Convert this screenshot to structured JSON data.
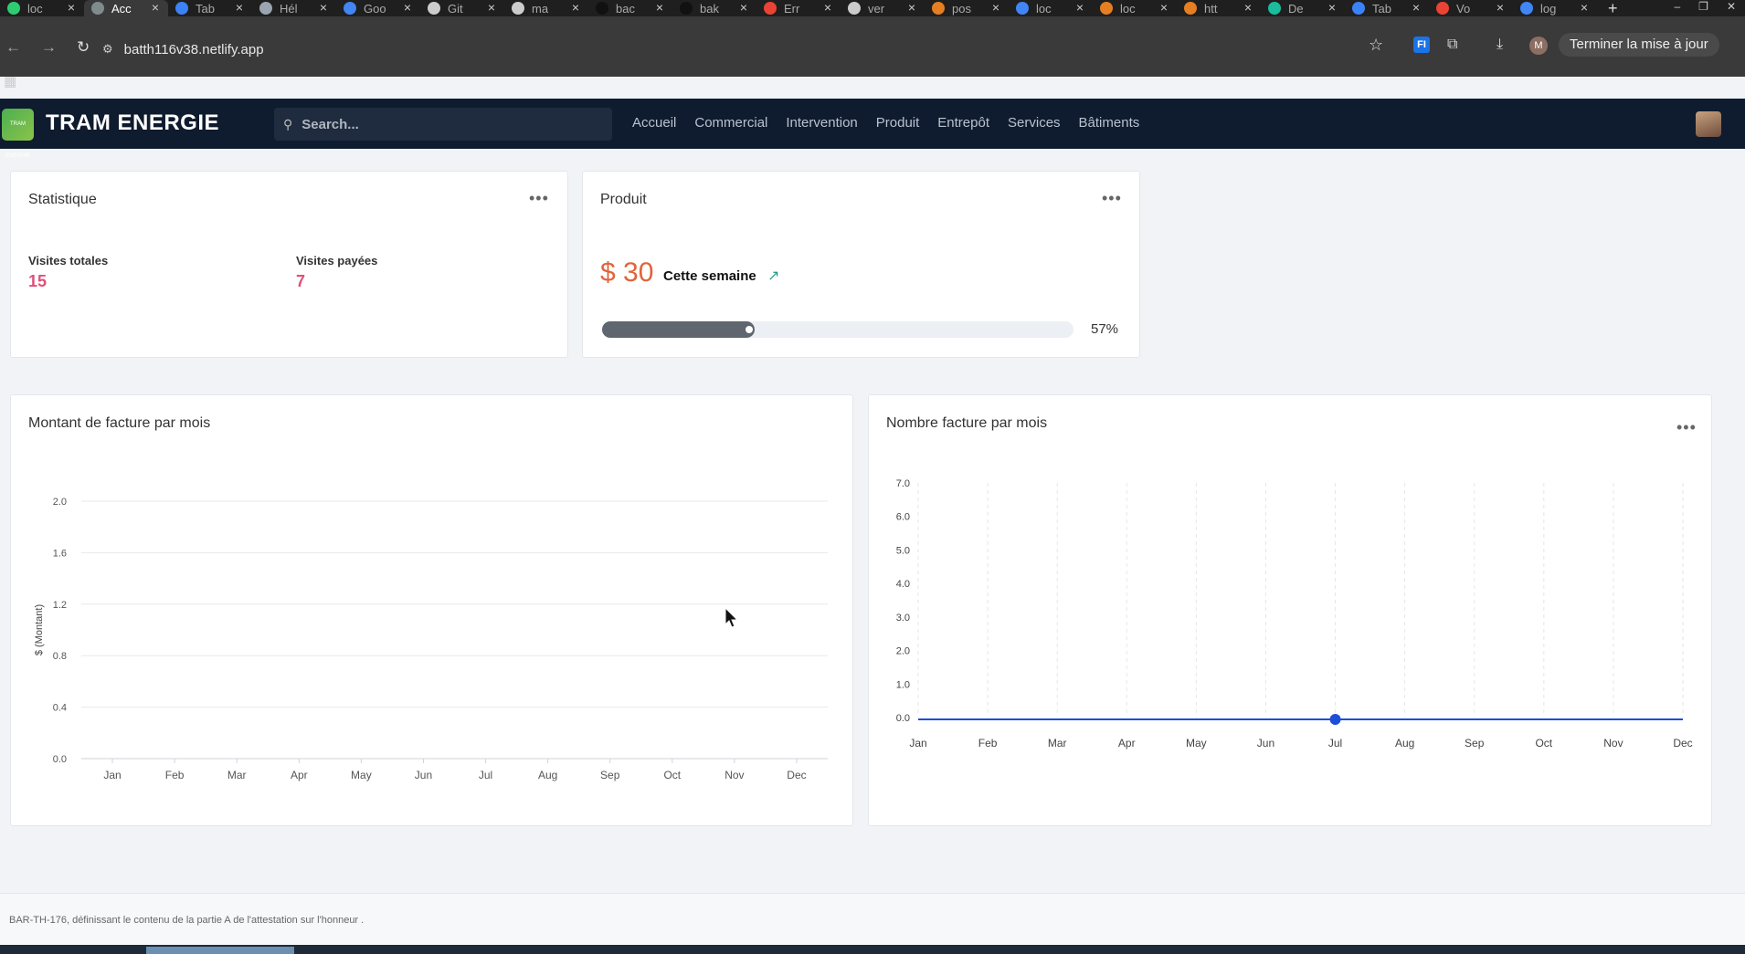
{
  "browser": {
    "tabs": [
      {
        "label": "loc",
        "color": "#2ecc71"
      },
      {
        "label": "Acc",
        "color": "#7f8c8d",
        "active": true
      },
      {
        "label": "Tab",
        "color": "#3b82f6"
      },
      {
        "label": "Hél",
        "color": "#9aa5b1"
      },
      {
        "label": "Goo",
        "color": "#4285f4"
      },
      {
        "label": "Git",
        "color": "#cccccc"
      },
      {
        "label": "ma",
        "color": "#cccccc"
      },
      {
        "label": "bac",
        "color": "#111111"
      },
      {
        "label": "bak",
        "color": "#111111"
      },
      {
        "label": "Err",
        "color": "#ea4335"
      },
      {
        "label": "ver",
        "color": "#cccccc"
      },
      {
        "label": "pos",
        "color": "#e67e22"
      },
      {
        "label": "loc",
        "color": "#4285f4"
      },
      {
        "label": "loc",
        "color": "#e67e22"
      },
      {
        "label": "htt",
        "color": "#e67e22"
      },
      {
        "label": "De",
        "color": "#1abc9c"
      },
      {
        "label": "Tab",
        "color": "#3b82f6"
      },
      {
        "label": "Vo",
        "color": "#ea4335"
      },
      {
        "label": "log",
        "color": "#4285f4"
      }
    ],
    "url": "batth116v38.netlify.app",
    "update_label": "Terminer la mise à jour",
    "profile_initial": "M",
    "ext_label": "FI"
  },
  "app": {
    "logo_text": "TRAM ENERGIE",
    "brand": "TRAM ENERGIE",
    "search_placeholder": "Search...",
    "nav": [
      "Accueil",
      "Commercial",
      "Intervention",
      "Produit",
      "Entrepôt",
      "Services",
      "Bâtiments"
    ]
  },
  "stat_card": {
    "title": "Statistique",
    "total_label": "Visites totales",
    "total_value": "15",
    "paid_label": "Visites payées",
    "paid_value": "7"
  },
  "product_card": {
    "title": "Produit",
    "price": "$ 30",
    "period": "Cette semaine",
    "progress": 57,
    "progress_label": "57%"
  },
  "chart_data": [
    {
      "type": "line",
      "title": "Montant de facture par mois",
      "ylabel": "$ (Montant)",
      "xlabel": "",
      "categories": [
        "Jan",
        "Feb",
        "Mar",
        "Apr",
        "May",
        "Jun",
        "Jul",
        "Aug",
        "Sep",
        "Oct",
        "Nov",
        "Dec"
      ],
      "yticks": [
        "0.0",
        "0.4",
        "0.8",
        "1.2",
        "1.6",
        "2.0"
      ],
      "ylim": [
        0,
        2
      ],
      "series": [],
      "grid": "horizontal"
    },
    {
      "type": "line",
      "title": "Nombre facture par mois",
      "ylabel": "",
      "xlabel": "",
      "categories": [
        "Jan",
        "Feb",
        "Mar",
        "Apr",
        "May",
        "Jun",
        "Jul",
        "Aug",
        "Sep",
        "Oct",
        "Nov",
        "Dec"
      ],
      "yticks": [
        "0.0",
        "1.0",
        "2.0",
        "3.0",
        "4.0",
        "5.0",
        "6.0",
        "7.0"
      ],
      "ylim": [
        0,
        7
      ],
      "series": [
        {
          "values": [
            0,
            0,
            0,
            0,
            0,
            0,
            0,
            0,
            0,
            0,
            0,
            0
          ],
          "color": "#1d4ed8",
          "highlight_index": 6
        }
      ],
      "grid": "vertical-dashed"
    }
  ],
  "footer": {
    "text": "BAR-TH-176, définissant le contenu de la partie A de l'attestation sur l'honneur ."
  }
}
